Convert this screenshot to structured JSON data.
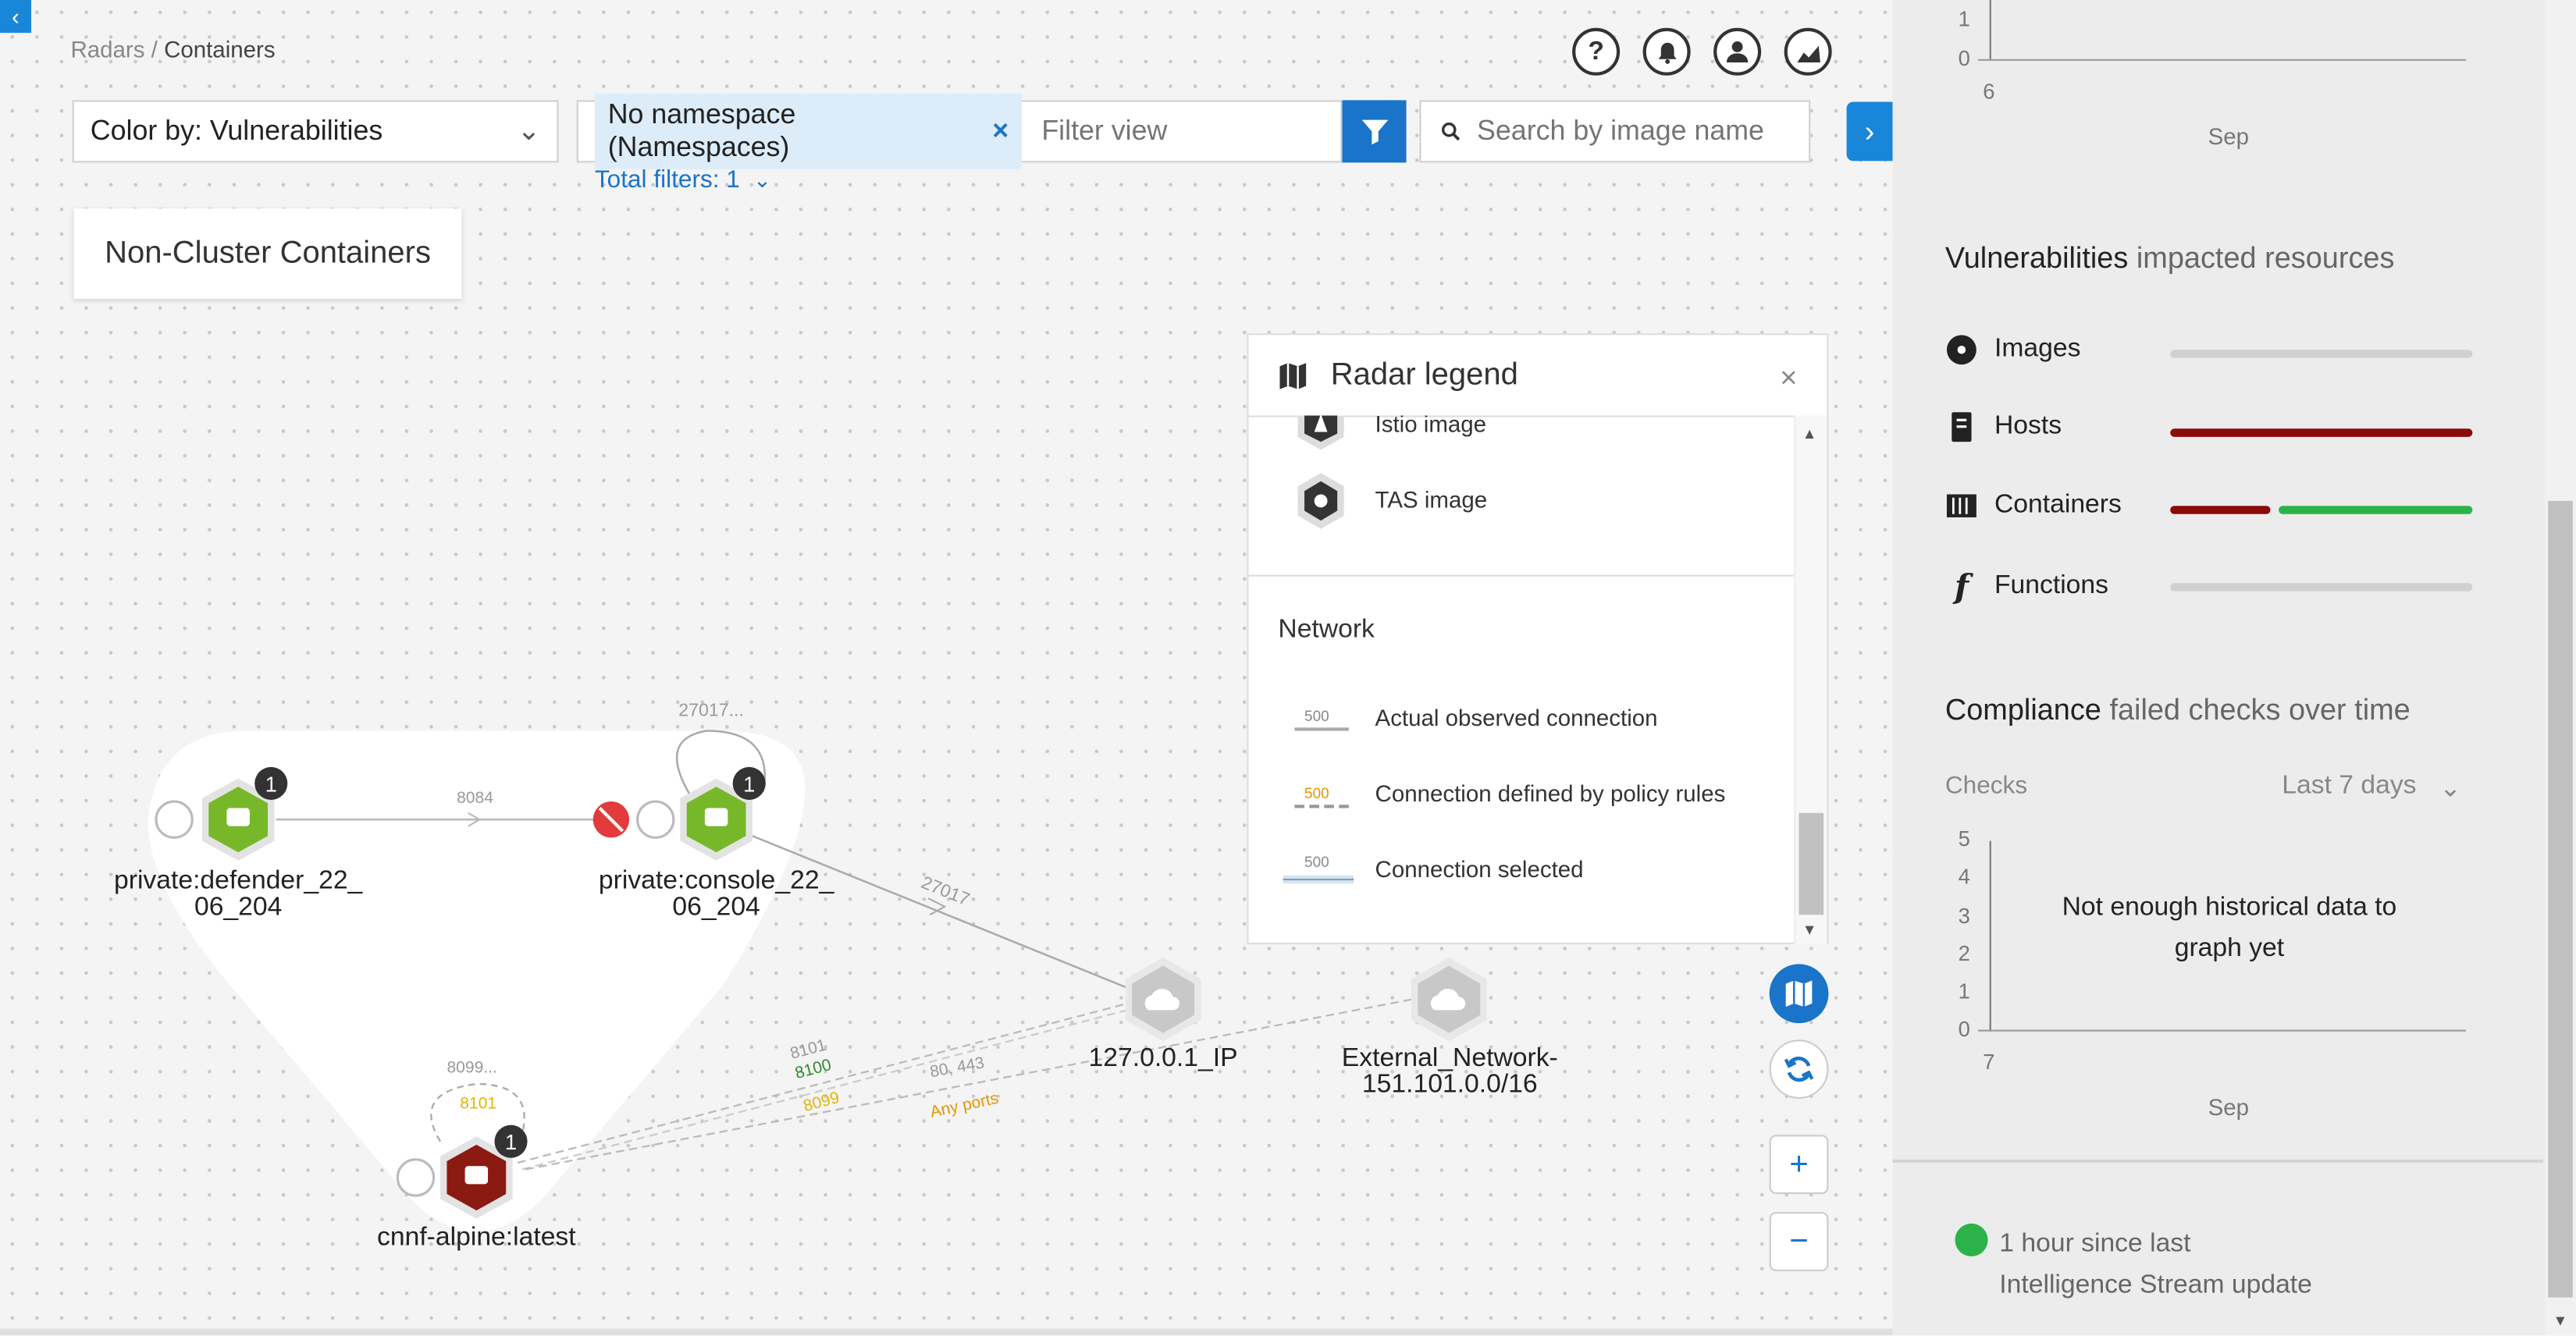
{
  "breadcrumb": {
    "root": "Radars",
    "separator": " / ",
    "current": "Containers"
  },
  "toolbar": {
    "color_by": "Color by: Vulnerabilities",
    "filter_chip": "No namespace (Namespaces)",
    "filter_placeholder": "Filter view",
    "search_placeholder": "Search by image name",
    "total_filters": "Total filters: 1"
  },
  "top_icons": [
    "help-icon",
    "bell-icon",
    "user-icon",
    "chart-icon"
  ],
  "cluster_label": "Non-Cluster Containers",
  "graph": {
    "nodes": {
      "defender": "private:defender_22_\n06_204",
      "console": "private:console_22_\n06_204",
      "alpine": "cnnf-alpine:latest",
      "ip": "127.0.0.1_IP",
      "external": "External_Network-\n151.101.0.0/16"
    },
    "badges": {
      "defender": "1",
      "console": "1",
      "alpine": "1"
    },
    "edges": {
      "def_to_console": "8084",
      "console_self": "27017...",
      "console_to_ip": "27017",
      "alpine_self_top": "8099...",
      "alpine_self_bottom": "8101",
      "alpine_to_ip_a": "8101",
      "alpine_to_ip_b": "8100",
      "alpine_to_ip_c": "8099",
      "alpine_to_ext": "80, 443",
      "alpine_to_ext_any": "Any ports"
    },
    "colors": {
      "green": "#77b82a",
      "dark_red": "#8b1a12",
      "grey_node": "#c8c8c8"
    }
  },
  "legend": {
    "title": "Radar legend",
    "items": [
      "Istio image",
      "TAS image"
    ],
    "network_title": "Network",
    "network_items": [
      {
        "sample": "500",
        "label": "Actual observed connection"
      },
      {
        "sample": "500",
        "label": "Connection defined by policy rules"
      },
      {
        "sample": "500",
        "label": "Connection selected"
      }
    ]
  },
  "right_panel": {
    "top_chart": {
      "yticks": [
        "1",
        "0"
      ],
      "xtick": "6",
      "xlabel": "Sep"
    },
    "vuln_title_bold": "Vulnerabilities",
    "vuln_title_light": "impacted resources",
    "resources": [
      {
        "label": "Images",
        "icon": "image-icon"
      },
      {
        "label": "Hosts",
        "icon": "host-icon"
      },
      {
        "label": "Containers",
        "icon": "container-icon"
      },
      {
        "label": "Functions",
        "icon": "function-icon"
      }
    ],
    "compliance_title_bold": "Compliance",
    "compliance_title_light": "failed checks over time",
    "checks_label": "Checks",
    "range_select": "Last 7 days",
    "compliance_chart": {
      "yticks": [
        "5",
        "4",
        "3",
        "2",
        "1",
        "0"
      ],
      "xtick": "7",
      "xlabel": "Sep",
      "message": "Not enough historical data to graph yet"
    },
    "status": {
      "line1": "1 hour since last",
      "line2": "Intelligence Stream update",
      "color": "#2bb34a"
    }
  }
}
